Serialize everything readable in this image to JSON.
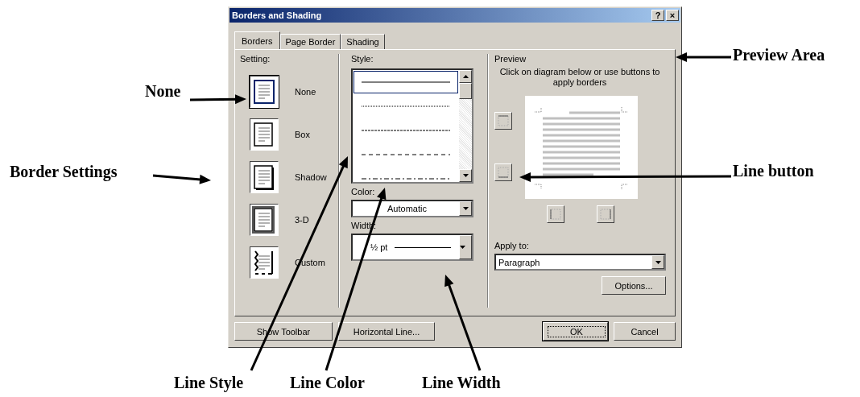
{
  "window": {
    "title": "Borders and Shading",
    "help_button": "?",
    "close_button": "×"
  },
  "tabs": [
    {
      "label": "Borders",
      "selected": true
    },
    {
      "label": "Page Border",
      "selected": false
    },
    {
      "label": "Shading",
      "selected": false
    }
  ],
  "setting": {
    "label": "Setting:",
    "items": [
      {
        "kind": "none",
        "label": "None",
        "selected": true
      },
      {
        "kind": "box",
        "label": "Box",
        "selected": false
      },
      {
        "kind": "shadow",
        "label": "Shadow",
        "selected": false
      },
      {
        "kind": "threed",
        "label": "3-D",
        "selected": false
      },
      {
        "kind": "custom",
        "label": "Custom",
        "selected": false
      }
    ]
  },
  "style": {
    "label": "Style:",
    "items": [
      {
        "kind": "solid",
        "selected": true
      },
      {
        "kind": "dotted",
        "selected": false
      },
      {
        "kind": "dashed",
        "selected": false
      },
      {
        "kind": "dashed-wide",
        "selected": false
      },
      {
        "kind": "dash-dot",
        "selected": false
      }
    ]
  },
  "color": {
    "label": "Color:",
    "value": "Automatic"
  },
  "width": {
    "label": "Width:",
    "value": "½ pt"
  },
  "preview": {
    "label": "Preview",
    "hint": "Click on diagram below or use buttons to apply borders"
  },
  "apply_to": {
    "label": "Apply to:",
    "value": "Paragraph"
  },
  "options_button": "Options...",
  "footer_buttons": [
    {
      "label": "Show Toolbar",
      "kind": "normal"
    },
    {
      "label": "Horizontal Line...",
      "kind": "normal"
    },
    {
      "label": "OK",
      "kind": "default"
    },
    {
      "label": "Cancel",
      "kind": "normal"
    }
  ],
  "annotations": [
    "None",
    "Border Settings",
    "Preview Area",
    "Line button",
    "Line Style",
    "Line Color",
    "Line Width"
  ]
}
